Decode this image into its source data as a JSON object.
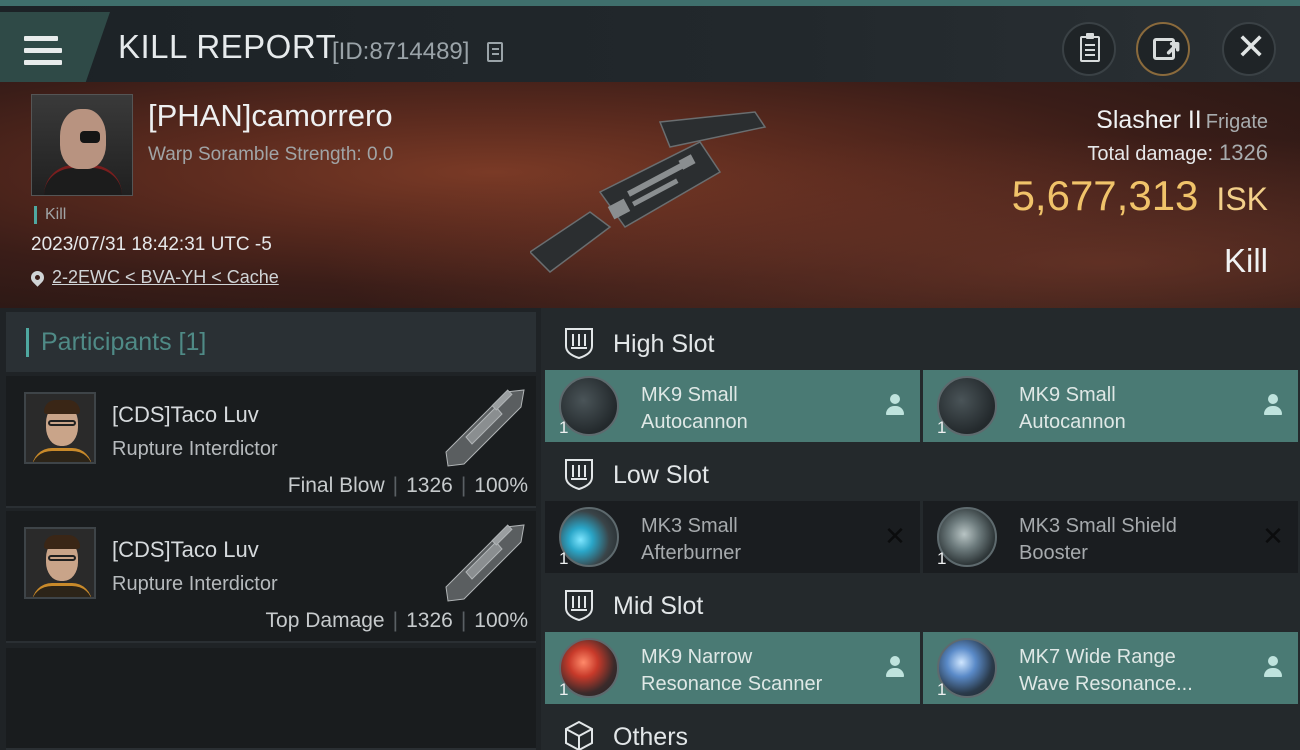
{
  "header": {
    "title": "KILL REPORT",
    "report_id": "[ID:8714489]"
  },
  "victim": {
    "pilot_name": "[PHAN]camorrero",
    "warp_scramble": "Warp Soramble Strength: 0.0",
    "kill_tag": "Kill",
    "datetime": "2023/07/31 18:42:31 UTC -5",
    "location": "2-2EWC < BVA-YH < Cache",
    "ship_name": "Slasher II",
    "ship_class": "Frigate",
    "total_damage_label": "Total damage:",
    "total_damage_value": "1326",
    "isk_value": "5,677,313",
    "isk_unit": "ISK",
    "result": "Kill"
  },
  "participants": {
    "header": "Participants [1]",
    "rows": [
      {
        "name": "[CDS]Taco Luv",
        "ship": "Rupture Interdictor",
        "role": "Final Blow",
        "damage": "1326",
        "percent": "100%"
      },
      {
        "name": "[CDS]Taco Luv",
        "ship": "Rupture Interdictor",
        "role": "Top Damage",
        "damage": "1326",
        "percent": "100%"
      }
    ]
  },
  "fittings": {
    "high_slot": {
      "label": "High Slot",
      "modules": [
        {
          "name_line1": "MK9 Small",
          "name_line2": "Autocannon",
          "qty": "1",
          "status": "fitted",
          "icon": "autocannon-icon"
        },
        {
          "name_line1": "MK9 Small",
          "name_line2": "Autocannon",
          "qty": "1",
          "status": "fitted",
          "icon": "autocannon-icon"
        }
      ]
    },
    "low_slot": {
      "label": "Low Slot",
      "modules": [
        {
          "name_line1": "MK3 Small",
          "name_line2": "Afterburner",
          "qty": "1",
          "status": "destroyed",
          "icon": "afterburner-icon"
        },
        {
          "name_line1": "MK3 Small Shield",
          "name_line2": "Booster",
          "qty": "1",
          "status": "destroyed",
          "icon": "shield-booster-icon"
        }
      ]
    },
    "mid_slot": {
      "label": "Mid Slot",
      "modules": [
        {
          "name_line1": "MK9 Narrow",
          "name_line2": "Resonance Scanner",
          "qty": "1",
          "status": "fitted",
          "icon": "scanner-icon"
        },
        {
          "name_line1": "MK7 Wide Range",
          "name_line2": "Wave Resonance...",
          "qty": "1",
          "status": "fitted",
          "icon": "scanner-icon"
        }
      ]
    },
    "others": {
      "label": "Others"
    }
  },
  "colors": {
    "accent_teal": "#4fa8a0",
    "fitted_bg": "#4a7a74",
    "isk_gold": "#f0c36a"
  }
}
